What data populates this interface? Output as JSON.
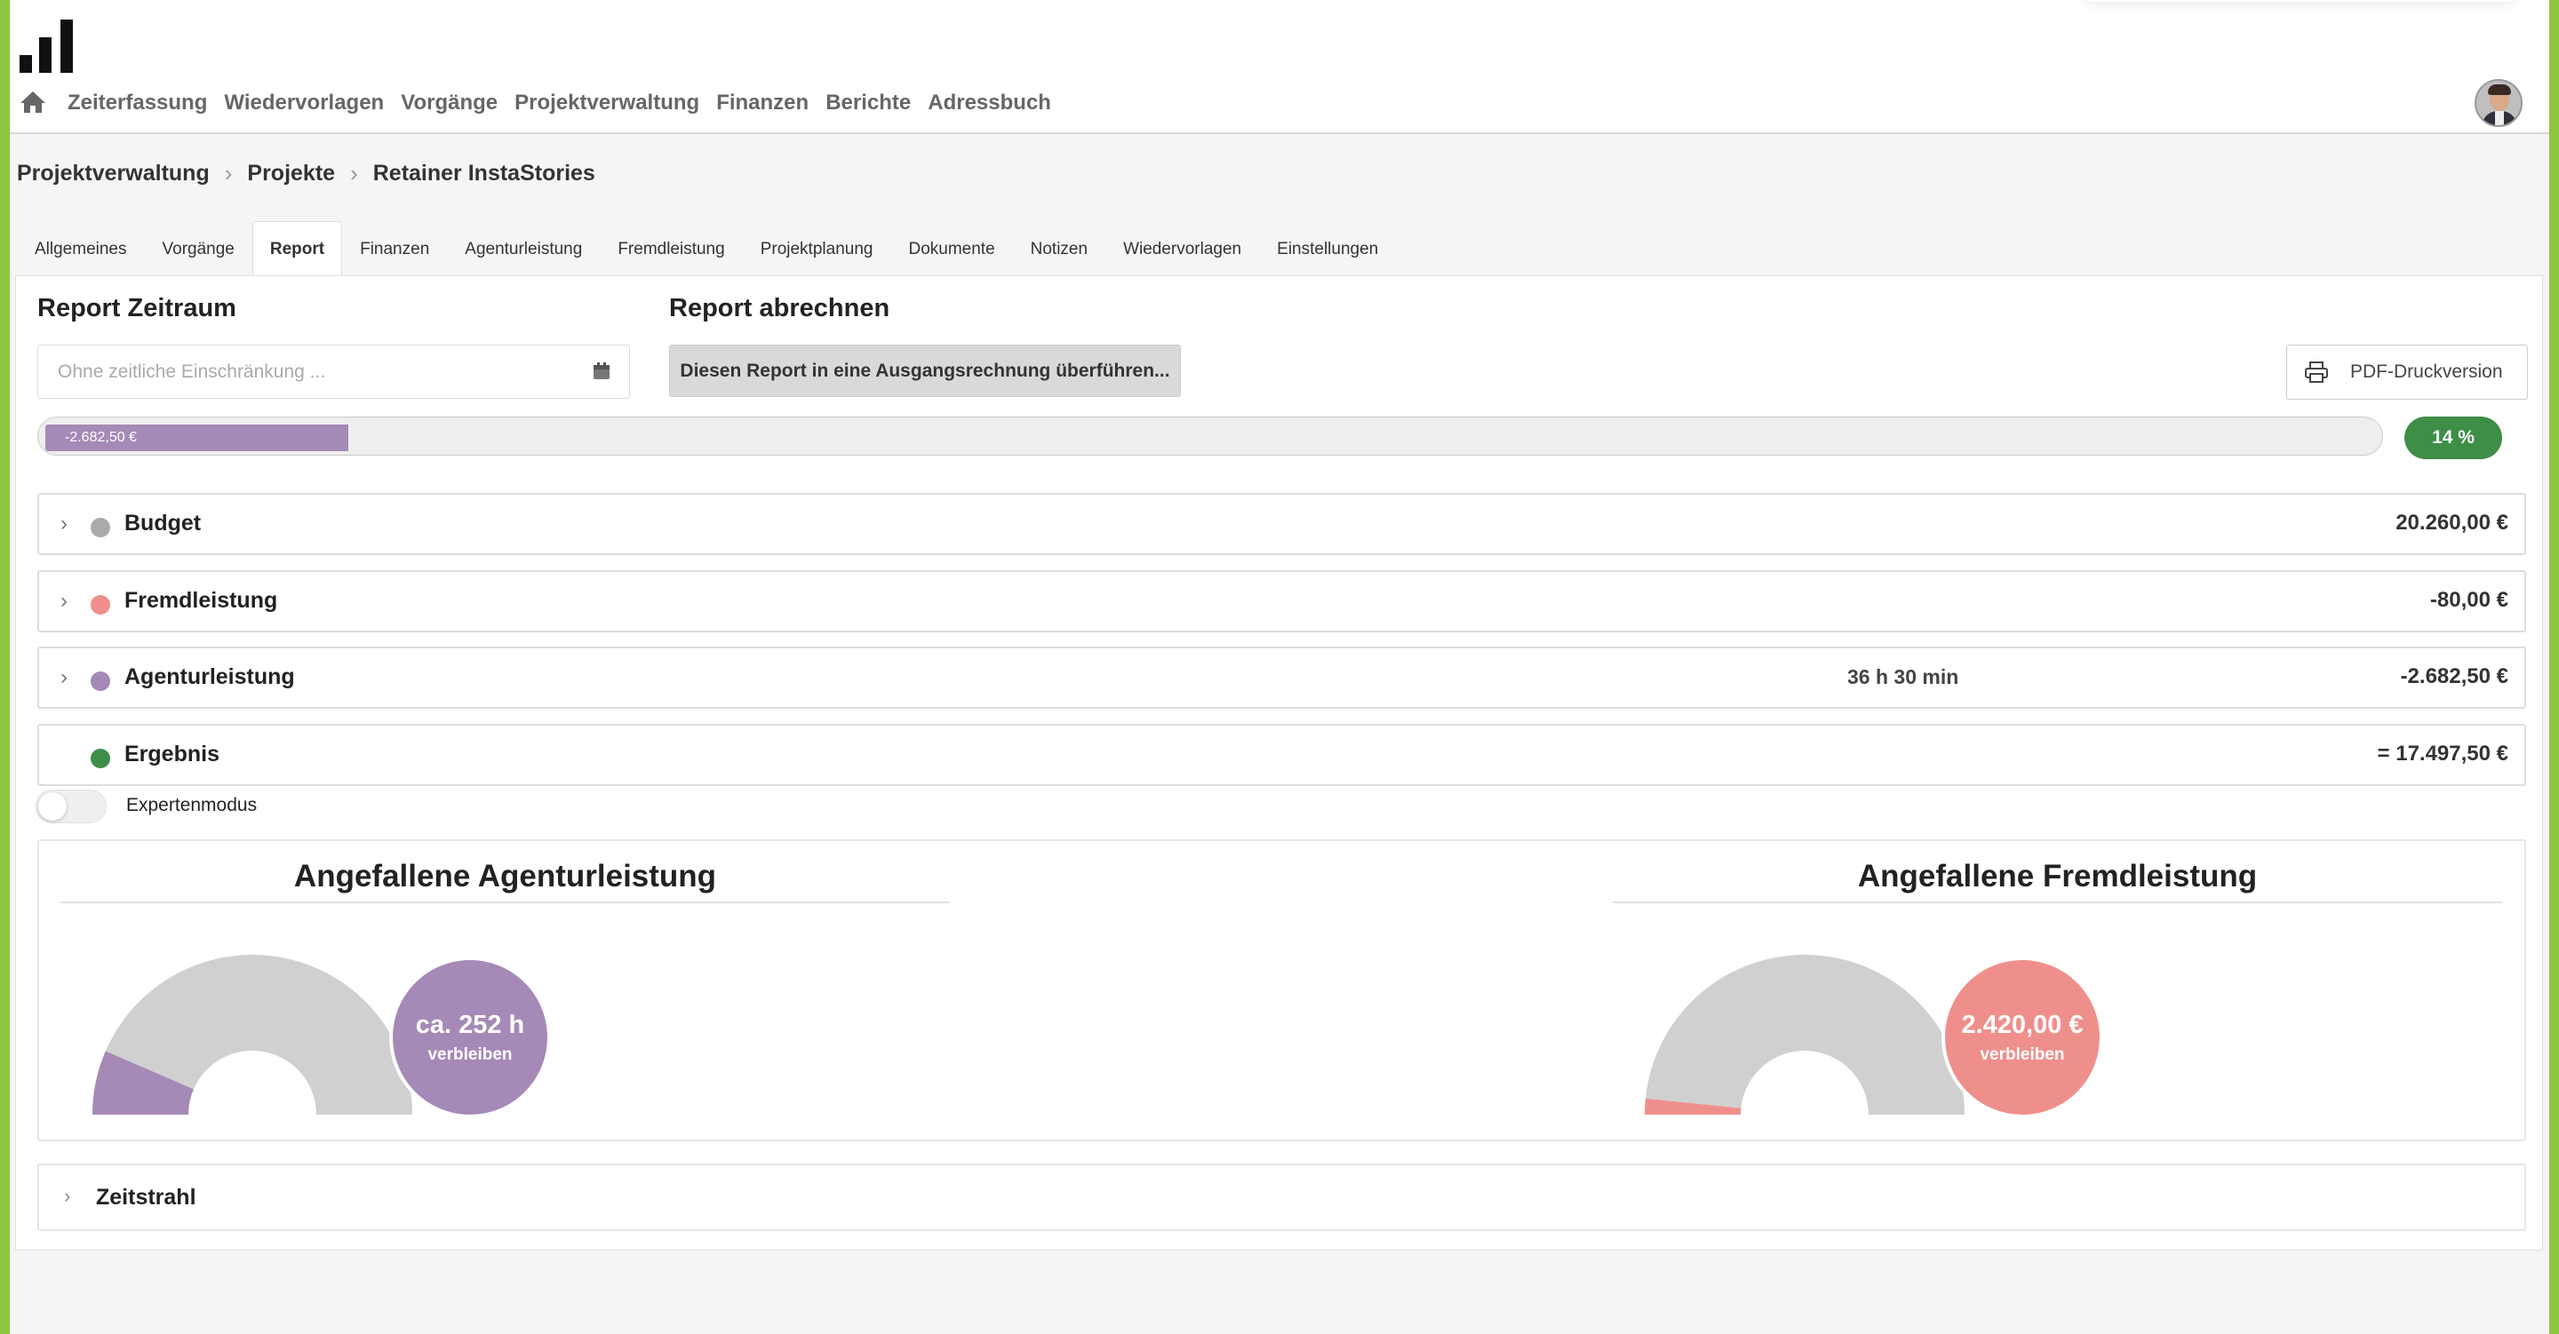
{
  "colors": {
    "accent_green": "#8dc63f",
    "agentur_purple": "#a589b7",
    "fremd_pink": "#ef8f8c",
    "budget_gray": "#aaaaaa",
    "result_green": "#3e8e47"
  },
  "nav": {
    "home_icon": "home-icon",
    "items": [
      "Zeiterfassung",
      "Wiedervorlagen",
      "Vorgänge",
      "Projektverwaltung",
      "Finanzen",
      "Berichte",
      "Adressbuch"
    ]
  },
  "breadcrumb": [
    "Projektverwaltung",
    "Projekte",
    "Retainer InstaStories"
  ],
  "tabs": {
    "items": [
      "Allgemeines",
      "Vorgänge",
      "Report",
      "Finanzen",
      "Agenturleistung",
      "Fremdleistung",
      "Projektplanung",
      "Dokumente",
      "Notizen",
      "Wiedervorlagen",
      "Einstellungen"
    ],
    "active": "Report"
  },
  "report": {
    "zeitraum_title": "Report Zeitraum",
    "abrechnen_title": "Report abrechnen",
    "date_placeholder": "Ohne zeitliche Einschränkung ...",
    "convert_button": "Diesen Report in eine Ausgangsrechnung überführen...",
    "pdf_button": "PDF-Druckversion",
    "progress_label": "-2.682,50 €",
    "progress_fraction": 0.13,
    "percent": "14 %"
  },
  "rows": [
    {
      "label": "Budget",
      "mid": "",
      "amount": "20.260,00 €",
      "color": "#aaaaaa",
      "expandable": true
    },
    {
      "label": "Fremdleistung",
      "mid": "",
      "amount": "-80,00 €",
      "color": "#ef8f8c",
      "expandable": true
    },
    {
      "label": "Agenturleistung",
      "mid": "36 h 30 min",
      "amount": "-2.682,50 €",
      "color": "#a589b7",
      "expandable": true
    },
    {
      "label": "Ergebnis",
      "mid": "",
      "amount": "= 17.497,50 €",
      "color": "#3e8e47",
      "expandable": false
    }
  ],
  "expert_mode": {
    "label": "Expertenmodus",
    "enabled": false
  },
  "charts": [
    {
      "title": "Angefallene Agenturleistung",
      "bubble_value": "ca. 252 h",
      "bubble_sub": "verbleiben",
      "used_fraction": 0.13,
      "color": "#a589b7"
    },
    {
      "title": "Angefallene Fremdleistung",
      "bubble_value": "2.420,00 €",
      "bubble_sub": "verbleiben",
      "used_fraction": 0.032,
      "color": "#ef8f8c"
    }
  ],
  "timeline": {
    "label": "Zeitstrahl"
  }
}
